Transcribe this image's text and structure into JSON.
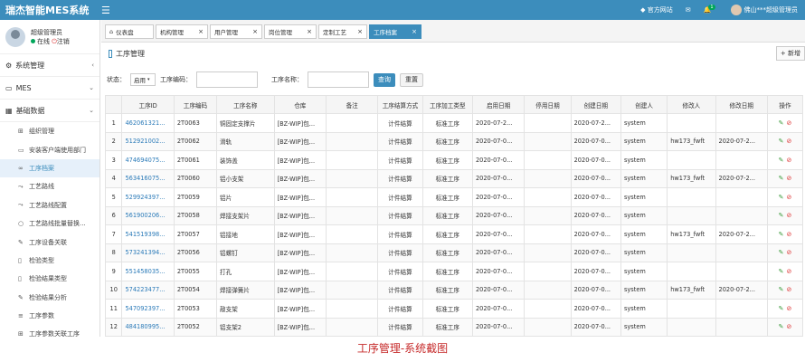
{
  "header": {
    "logo": "瑞杰智能MES系统",
    "official_site": "官方网站",
    "notif_count": "1",
    "user_text": "佛山***超级管理员"
  },
  "sidebar": {
    "user_name": "超级管理员",
    "status_online": "在线",
    "logout": "注销",
    "sections": [
      {
        "label": "系统管理"
      },
      {
        "label": "MES"
      },
      {
        "label": "基础数据"
      }
    ],
    "items": [
      {
        "label": "组织管理",
        "icon": "sitemap-icon"
      },
      {
        "label": "安装客户端使用部门",
        "icon": "monitor-icon"
      },
      {
        "label": "工序档案",
        "icon": "link-icon"
      },
      {
        "label": "工艺路线",
        "icon": "flow-icon"
      },
      {
        "label": "工艺路线配置",
        "icon": "flow-icon"
      },
      {
        "label": "工艺路线批量替换...",
        "icon": "circle-icon"
      },
      {
        "label": "工序设备关联",
        "icon": "tool-icon"
      },
      {
        "label": "检验类型",
        "icon": "file-icon"
      },
      {
        "label": "检验结果类型",
        "icon": "file-icon"
      },
      {
        "label": "检验结果分析",
        "icon": "edit-icon"
      },
      {
        "label": "工序参数",
        "icon": "list-icon"
      },
      {
        "label": "工序参数关联工序",
        "icon": "sitemap-icon"
      }
    ]
  },
  "tabs": [
    {
      "label": "仪表盘"
    },
    {
      "label": "机构管理"
    },
    {
      "label": "用户管理"
    },
    {
      "label": "岗位管理"
    },
    {
      "label": "定制工艺"
    },
    {
      "label": "工序档案"
    }
  ],
  "page": {
    "title": "工序管理",
    "add_label": "+ 新增"
  },
  "filter": {
    "status_label": "状态：",
    "status_value": "启用",
    "code_label": "工序编码：",
    "name_label": "工序名称：",
    "search_btn": "查询",
    "reset_btn": "重置"
  },
  "table": {
    "headers": [
      "",
      "工序ID",
      "工序编码",
      "工序名称",
      "仓库",
      "备注",
      "工序结算方式",
      "工序加工类型",
      "启用日期",
      "停用日期",
      "创建日期",
      "创建人",
      "修改人",
      "修改日期",
      "操作"
    ],
    "rows": [
      [
        "1",
        "462061321...",
        "2T0063",
        "铜固定支撑片",
        "[BZ-WIP]包...",
        "",
        "计件结算",
        "标准工序",
        "2020-07-2...",
        "",
        "2020-07-2...",
        "system",
        "",
        "",
        ""
      ],
      [
        "2",
        "512921002...",
        "2T0062",
        "滑轨",
        "[BZ-WIP]包...",
        "",
        "计件结算",
        "标准工序",
        "2020-07-0...",
        "",
        "2020-07-0...",
        "system",
        "hw173_fwft",
        "2020-07-2...",
        ""
      ],
      [
        "3",
        "474694075...",
        "2T0061",
        "装饰盖",
        "[BZ-WIP]包...",
        "",
        "计件结算",
        "标准工序",
        "2020-07-0...",
        "",
        "2020-07-0...",
        "system",
        "",
        "",
        ""
      ],
      [
        "4",
        "563416075...",
        "2T0060",
        "铝小支架",
        "[BZ-WIP]包...",
        "",
        "计件结算",
        "标准工序",
        "2020-07-0...",
        "",
        "2020-07-0...",
        "system",
        "hw173_fwft",
        "2020-07-2...",
        ""
      ],
      [
        "5",
        "529924397...",
        "2T0059",
        "铝片",
        "[BZ-WIP]包...",
        "",
        "计件结算",
        "标准工序",
        "2020-07-0...",
        "",
        "2020-07-0...",
        "system",
        "",
        "",
        ""
      ],
      [
        "6",
        "561900206...",
        "2T0058",
        "焊接支架片",
        "[BZ-WIP]包...",
        "",
        "计件结算",
        "标准工序",
        "2020-07-0...",
        "",
        "2020-07-0...",
        "system",
        "",
        "",
        ""
      ],
      [
        "7",
        "541519398...",
        "2T0057",
        "铝接地",
        "[BZ-WIP]包...",
        "",
        "计件结算",
        "标准工序",
        "2020-07-0...",
        "",
        "2020-07-0...",
        "system",
        "hw173_fwft",
        "2020-07-2...",
        ""
      ],
      [
        "8",
        "573241394...",
        "2T0056",
        "铝螺钉",
        "[BZ-WIP]包...",
        "",
        "计件结算",
        "标准工序",
        "2020-07-0...",
        "",
        "2020-07-0...",
        "system",
        "",
        "",
        ""
      ],
      [
        "9",
        "551458035...",
        "2T0055",
        "打孔",
        "[BZ-WIP]包...",
        "",
        "计件结算",
        "标准工序",
        "2020-07-0...",
        "",
        "2020-07-0...",
        "system",
        "",
        "",
        ""
      ],
      [
        "10",
        "574223477...",
        "2T0054",
        "焊接弹簧片",
        "[BZ-WIP]包...",
        "",
        "计件结算",
        "标准工序",
        "2020-07-0...",
        "",
        "2020-07-0...",
        "system",
        "hw173_fwft",
        "2020-07-2...",
        ""
      ],
      [
        "11",
        "547092397...",
        "2T0053",
        "敲支架",
        "[BZ-WIP]包...",
        "",
        "计件结算",
        "标准工序",
        "2020-07-0...",
        "",
        "2020-07-0...",
        "system",
        "",
        "",
        ""
      ],
      [
        "12",
        "484180995...",
        "2T0052",
        "铝支架2",
        "[BZ-WIP]包...",
        "",
        "计件结算",
        "标准工序",
        "2020-07-0...",
        "",
        "2020-07-0...",
        "system",
        "",
        "",
        ""
      ]
    ]
  },
  "caption": "工序管理-系统截图"
}
